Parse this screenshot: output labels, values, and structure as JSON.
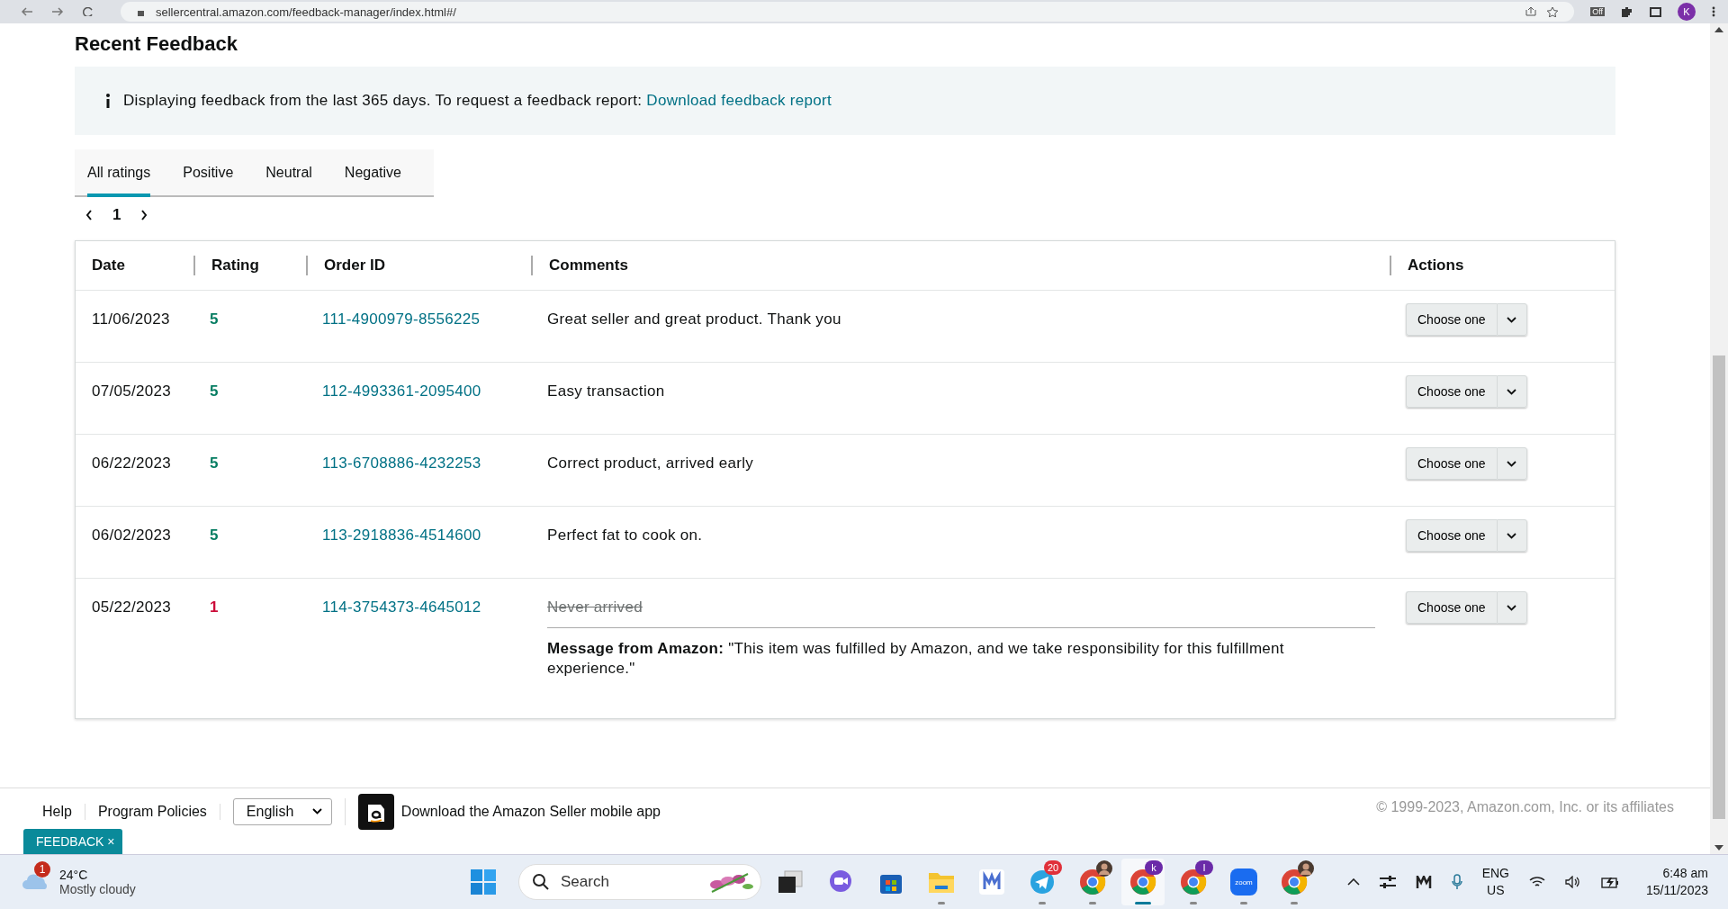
{
  "browser": {
    "url": "sellercentral.amazon.com/feedback-manager/index.html#/",
    "extension_badge": "Off",
    "profile": "K"
  },
  "title": "Recent Feedback",
  "info": {
    "text": "Displaying feedback from the last 365 days. To request a feedback report:",
    "link": "Download feedback report"
  },
  "tabs": [
    {
      "label": "All ratings",
      "selected": true
    },
    {
      "label": "Positive",
      "selected": false
    },
    {
      "label": "Neutral",
      "selected": false
    },
    {
      "label": "Negative",
      "selected": false
    }
  ],
  "pager": {
    "page": "1"
  },
  "table": {
    "columns": [
      "Date",
      "Rating",
      "Order ID",
      "Comments",
      "Actions"
    ],
    "rows": [
      {
        "date": "11/06/2023",
        "rating": "5",
        "kind": "positive",
        "order_id": "111-4900979-8556225",
        "comment": "Great seller and great product. Thank you",
        "struck": false,
        "action": "Choose one"
      },
      {
        "date": "07/05/2023",
        "rating": "5",
        "kind": "positive",
        "order_id": "112-4993361-2095400",
        "comment": "Easy transaction",
        "struck": false,
        "action": "Choose one"
      },
      {
        "date": "06/22/2023",
        "rating": "5",
        "kind": "positive",
        "order_id": "113-6708886-4232253",
        "comment": "Correct product, arrived early",
        "struck": false,
        "action": "Choose one"
      },
      {
        "date": "06/02/2023",
        "rating": "5",
        "kind": "positive",
        "order_id": "113-2918836-4514600",
        "comment": "Perfect fat to cook on.",
        "struck": false,
        "action": "Choose one"
      },
      {
        "date": "05/22/2023",
        "rating": "1",
        "kind": "negative",
        "order_id": "114-3754373-4645012",
        "comment": "Never arrived",
        "struck": true,
        "message": "**Message from Amazon:** \"This item was fulfilled by Amazon, and we take responsibility for this fulfillment experience.\"",
        "action": "Choose one"
      }
    ]
  },
  "footer": {
    "links": [
      "Help",
      "Program Policies"
    ],
    "language": "English",
    "app_link": "Download the Amazon Seller mobile app",
    "copyright": "© 1999-2023, Amazon.com, Inc. or its affiliates"
  },
  "feedback_tab": {
    "label": "FEEDBACK",
    "close": "×"
  },
  "taskbar": {
    "weather": {
      "badge": "1",
      "temp": "24°C",
      "condition": "Mostly cloudy"
    },
    "search": {
      "placeholder": "Search"
    },
    "apps": [
      {
        "kind": "task-view",
        "running": false,
        "active": false
      },
      {
        "kind": "meet",
        "running": false,
        "active": false
      },
      {
        "kind": "store",
        "running": false,
        "active": false
      },
      {
        "kind": "explorer",
        "running": true,
        "active": false
      },
      {
        "kind": "m-app",
        "running": false,
        "active": false
      },
      {
        "kind": "telegram",
        "running": true,
        "active": false,
        "badge": "20"
      },
      {
        "kind": "chrome",
        "running": true,
        "active": false,
        "avatar": true
      },
      {
        "kind": "chrome",
        "running": true,
        "active": true,
        "badge": "k"
      },
      {
        "kind": "chrome",
        "running": true,
        "active": false,
        "badge": "I"
      },
      {
        "kind": "zoom",
        "running": true,
        "active": false,
        "label": "zoom"
      },
      {
        "kind": "chrome",
        "running": true,
        "active": false,
        "avatar": true
      }
    ],
    "lang": "ENG",
    "region": "US",
    "time": "6:48 am",
    "date": "15/11/2023"
  }
}
